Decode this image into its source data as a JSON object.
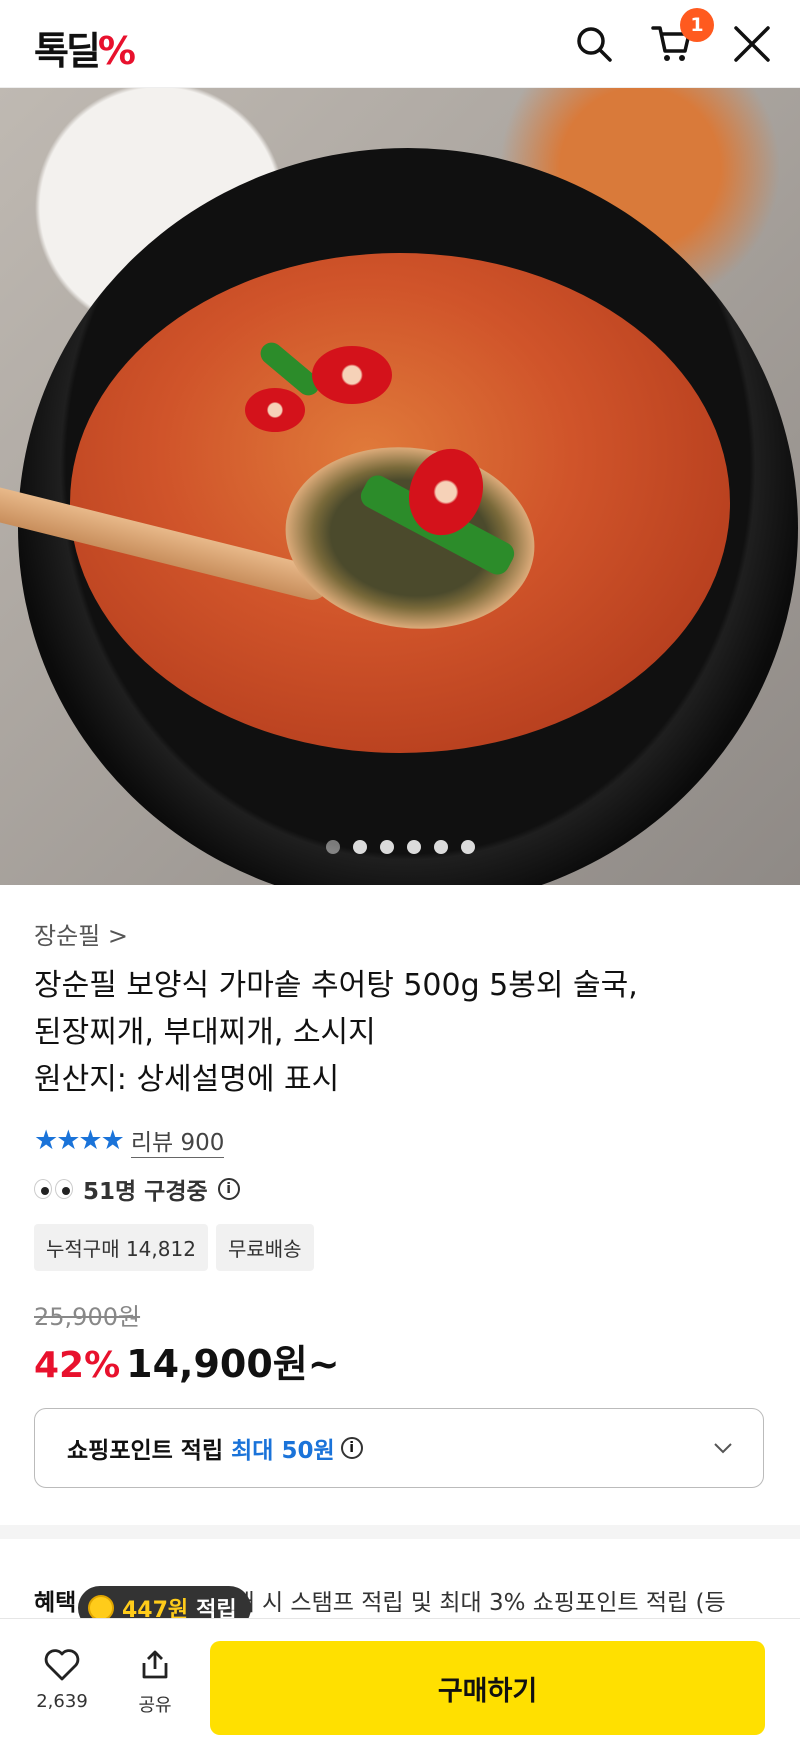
{
  "header": {
    "logo_text": "톡딜",
    "logo_symbol": "%",
    "cart_count": "1",
    "icons": [
      "search-icon",
      "cart-icon",
      "close-icon"
    ]
  },
  "hero": {
    "slide_count": 6,
    "active_slide": 1
  },
  "product": {
    "brand": "장순필 >",
    "title_line1": "장순필 보양식 가마솥 추어탕 500g 5봉외 술국,",
    "title_line2": "된장찌개, 부대찌개, 소시지",
    "title_line3": "원산지: 상세설명에 표시",
    "stars": "★★★★",
    "review_label": "리뷰 900",
    "viewers": "51명 구경중",
    "tags": [
      "누적구매 14,812",
      "무료배송"
    ],
    "original_price": "25,900원",
    "discount": "42%",
    "price": "14,900원~"
  },
  "points": {
    "label": "쇼핑포인트 적립",
    "max": "최대 50원"
  },
  "benefit": {
    "label": "혜택",
    "text": "구매 시 스탬프 적립 및 최대 3% 쇼핑포인트 적립 (등"
  },
  "tooltip": {
    "amount": "447원",
    "suffix": "적립"
  },
  "bottom_bar": {
    "like_count": "2,639",
    "share_label": "공유",
    "buy_label": "구매하기"
  },
  "colors": {
    "brand_red": "#e8112d",
    "link_blue": "#1a73d9",
    "buy_yellow": "#ffe000",
    "badge_orange": "#ff5a1f"
  }
}
